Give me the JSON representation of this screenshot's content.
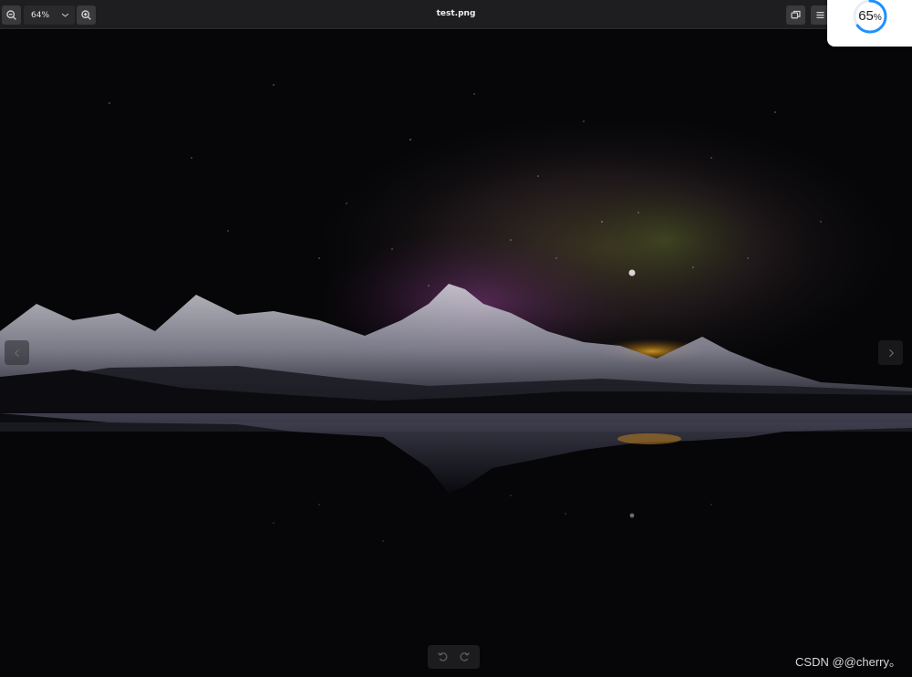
{
  "toolbar": {
    "zoom_value": "64%",
    "file_title": "test.png",
    "icons": {
      "zoom_out": "zoom-out-icon",
      "zoom_dropdown": "chevron-down-icon",
      "zoom_in": "zoom-in-icon",
      "window_mode": "window-icon",
      "menu": "menu-icon"
    }
  },
  "viewer": {
    "image_subject": "starry night sky over snow-capped mountains reflected in a lake",
    "nav": {
      "prev_icon": "chevron-left-icon",
      "next_icon": "chevron-right-icon"
    },
    "rotate": {
      "left_icon": "rotate-left-icon",
      "right_icon": "rotate-right-icon"
    }
  },
  "progress_widget": {
    "number": "65",
    "unit": "%",
    "progress_fraction": 0.65,
    "accent_color": "#1e90ff"
  },
  "watermark": "CSDN @@cherry。"
}
